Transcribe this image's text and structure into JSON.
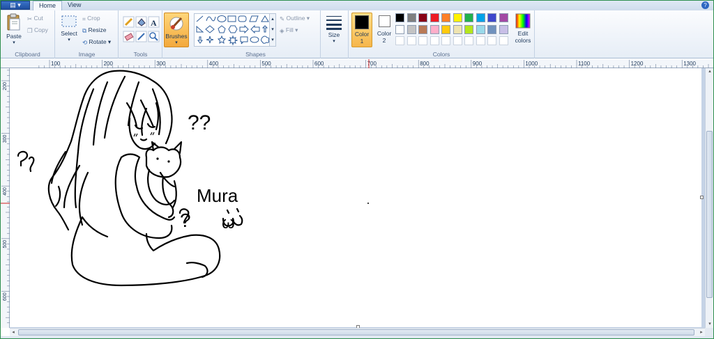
{
  "tabs": {
    "menu": "▤ ▾",
    "home": "Home",
    "view": "View",
    "help": "?"
  },
  "clipboard": {
    "label": "Clipboard",
    "paste": "Paste",
    "cut": "Cut",
    "copy": "Copy"
  },
  "image": {
    "label": "Image",
    "select": "Select",
    "crop": "Crop",
    "resize": "Resize",
    "rotate": "Rotate"
  },
  "tools": {
    "label": "Tools"
  },
  "brushes": {
    "label": "Brushes"
  },
  "shapes": {
    "label": "Shapes",
    "outline": "Outline",
    "fill": "Fill"
  },
  "size": {
    "label": "Size"
  },
  "color1": {
    "label": "Color",
    "num": "1",
    "value": "#000000"
  },
  "color2": {
    "label": "Color",
    "num": "2",
    "value": "#ffffff"
  },
  "colors": {
    "label": "Colors",
    "edit_line1": "Edit",
    "edit_line2": "colors",
    "row1": [
      "#000000",
      "#7f7f7f",
      "#880015",
      "#ed1c24",
      "#ff7f27",
      "#fff200",
      "#22b14c",
      "#00a2e8",
      "#3f48cc",
      "#a349a4"
    ],
    "row2": [
      "#ffffff",
      "#c3c3c3",
      "#b97a57",
      "#ffaec9",
      "#ffc90e",
      "#efe4b0",
      "#b5e61d",
      "#99d9ea",
      "#7092be",
      "#c8bfe7"
    ],
    "row3": [
      "#ffffff",
      "#ffffff",
      "#ffffff",
      "#ffffff",
      "#ffffff",
      "#ffffff",
      "#ffffff",
      "#ffffff",
      "#ffffff",
      "#ffffff"
    ]
  },
  "ruler": {
    "top": [
      "100",
      "200",
      "300",
      "400",
      "500",
      "600",
      "700",
      "800",
      "900",
      "1000",
      "1100",
      "1200",
      "1300"
    ],
    "left": [
      "200",
      "300",
      "400",
      "500",
      "600"
    ]
  },
  "drawing": {
    "text_qq": "??",
    "text_name": "Mura",
    "text_q": "?",
    "text_face": "ω"
  }
}
